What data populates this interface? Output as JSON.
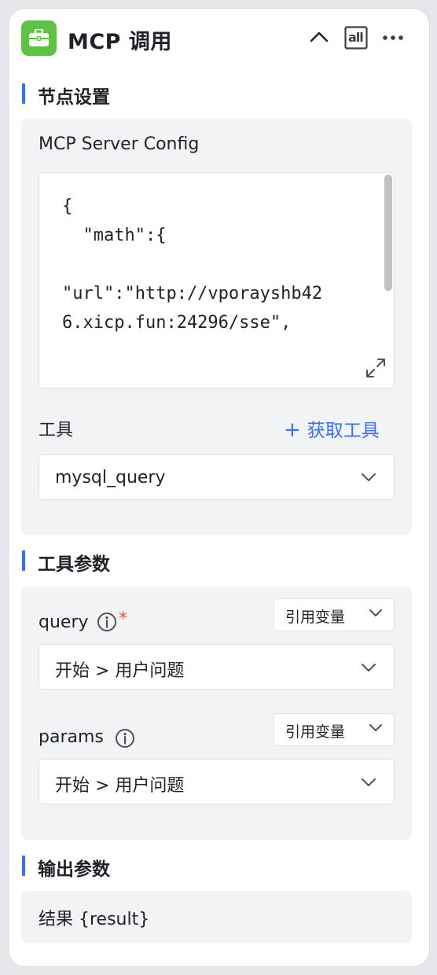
{
  "header": {
    "title": "MCP 调用",
    "icon": "toolbox-icon",
    "collapse_icon": "chevron-up-icon",
    "all_label": "all",
    "more_icon": "more-icon"
  },
  "node_settings": {
    "section_title": "节点设置",
    "config_label": "MCP Server Config",
    "config_lines": [
      "{",
      "  \"math\":{",
      "",
      "\"url\":\"http://vporayshb42",
      "6.xicp.fun:24296/sse\","
    ],
    "tools_label": "工具",
    "fetch_tools_label": "获取工具",
    "tool_selected": "mysql_query"
  },
  "tool_params": {
    "section_title": "工具参数",
    "params": [
      {
        "name": "query",
        "required": true,
        "mode": "引用变量",
        "value": "开始 > 用户问题"
      },
      {
        "name": "params",
        "required": false,
        "mode": "引用变量",
        "value": "开始 > 用户问题"
      }
    ]
  },
  "output_params": {
    "section_title": "输出参数",
    "result": "结果 {result}"
  },
  "colors": {
    "accent": "#3370ff",
    "app_icon_bg": "#5cc343",
    "required": "#f54a45",
    "panel_bg": "#f2f3f5"
  }
}
